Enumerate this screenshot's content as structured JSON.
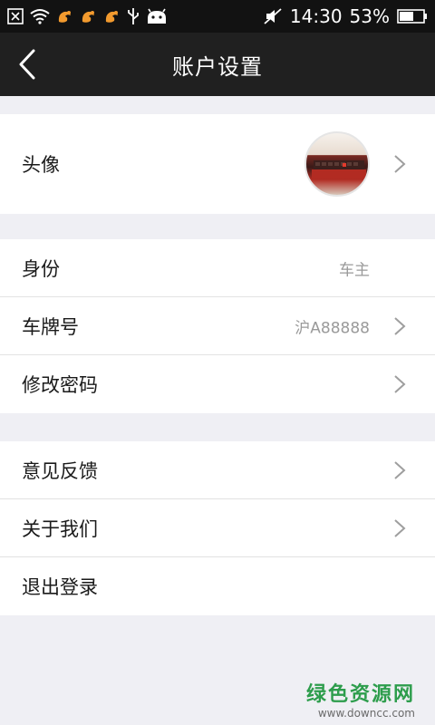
{
  "status_bar": {
    "time": "14:30",
    "battery": "53%"
  },
  "header": {
    "title": "账户设置"
  },
  "groups": [
    {
      "items": [
        {
          "label": "头像"
        }
      ]
    },
    {
      "items": [
        {
          "label": "身份",
          "value": "车主"
        },
        {
          "label": "车牌号",
          "value": "沪A88888"
        },
        {
          "label": "修改密码"
        }
      ]
    },
    {
      "items": [
        {
          "label": "意见反馈"
        },
        {
          "label": "关于我们"
        },
        {
          "label": "退出登录"
        }
      ]
    }
  ],
  "icons": {
    "back": "chevron-left-icon",
    "row_arrow": "chevron-right-icon"
  },
  "watermark": {
    "name": "绿色资源网",
    "url": "www.downcc.com"
  },
  "colors": {
    "statusbar": "#121212",
    "titlebar": "#202020",
    "background": "#efeff4",
    "watermark": "#2d9d4c"
  }
}
